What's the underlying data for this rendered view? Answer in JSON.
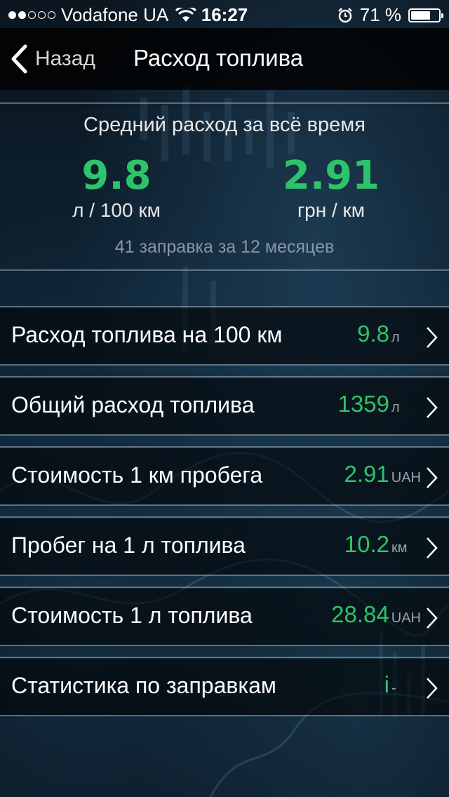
{
  "status_bar": {
    "carrier": "Vodafone UA",
    "time": "16:27",
    "battery_percent": "71 %",
    "battery_level": 0.71,
    "signal_bars": 2,
    "signal_total": 5
  },
  "nav": {
    "back_label": "Назад",
    "title": "Расход топлива"
  },
  "summary": {
    "title": "Средний расход за всё время",
    "consumption_value": "9.8",
    "consumption_unit": "л / 100 км",
    "cost_value": "2.91",
    "cost_unit": "грн / км",
    "note": "41 заправка за 12 месяцев"
  },
  "rows": [
    {
      "label": "Расход топлива на 100 км",
      "value": "9.8",
      "unit": "л"
    },
    {
      "label": "Общий расход топлива",
      "value": "1359",
      "unit": "л"
    },
    {
      "label": "Стоимость 1 км пробега",
      "value": "2.91",
      "unit": "UAH"
    },
    {
      "label": "Пробег на 1 л топлива",
      "value": "10.2",
      "unit": "км"
    },
    {
      "label": "Стоимость 1 л топлива",
      "value": "28.84",
      "unit": "UAH"
    },
    {
      "label": "Статистика по заправкам",
      "value": "i",
      "unit": "-"
    }
  ],
  "colors": {
    "accent_green": "#2ec36a",
    "background": "#0a1824"
  }
}
